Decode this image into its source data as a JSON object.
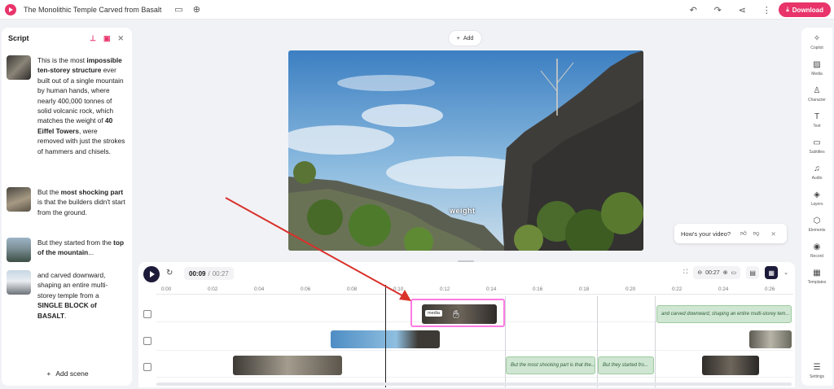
{
  "header": {
    "title": "The Monolithic Temple Carved from Basalt",
    "download_label": "Download"
  },
  "script_panel": {
    "title": "Script",
    "add_scene_label": "Add scene",
    "scenes": [
      {
        "pre": "This is the most ",
        "b1": "impossible ten-storey structure",
        "mid": " ever built out of a single mountain by human hands, where nearly 400,000 tonnes of solid volcanic rock, which matches the weight of ",
        "b2": "40 Eiffel Towers",
        "post": ", were removed with just the strokes of hammers and chisels."
      },
      {
        "pre": "But the ",
        "b1": "most shocking part",
        "mid": " is that the builders didn't start from the ground.",
        "b2": "",
        "post": ""
      },
      {
        "pre": "But they started from the ",
        "b1": "top of the mountain",
        "mid": "...",
        "b2": "",
        "post": ""
      },
      {
        "pre": "and carved downward, shaping an entire multi-storey temple from a ",
        "b1": "SINGLE BLOCK of BASALT",
        "mid": ".",
        "b2": "",
        "post": ""
      }
    ]
  },
  "canvas": {
    "add_label": "Add",
    "caption_word": "weight"
  },
  "feedback": {
    "question": "How's your video?"
  },
  "timeline": {
    "current_time": "00:09",
    "separator": "/",
    "total_time": "00:27",
    "zoom_value": "00:27",
    "ruler_ticks": [
      "0:00",
      "0:02",
      "0:04",
      "0:06",
      "0:08",
      "0:10",
      "0:12",
      "0:14",
      "0:16",
      "0:18",
      "0:20",
      "0:22",
      "0:24",
      "0:26"
    ],
    "media_tag": "media",
    "text_clips": [
      "and carved downward, shaping an entire multi-storey tem...",
      "But the most shocking part is that the...",
      "But they started fro..."
    ]
  },
  "rail": [
    {
      "label": "Copilot",
      "icon": "sparkle-icon"
    },
    {
      "label": "Media",
      "icon": "image-icon"
    },
    {
      "label": "Character",
      "icon": "person-icon"
    },
    {
      "label": "Text",
      "icon": "text-icon"
    },
    {
      "label": "Subtitles",
      "icon": "subtitles-icon"
    },
    {
      "label": "Audio",
      "icon": "music-icon"
    },
    {
      "label": "Layers",
      "icon": "layers-icon"
    },
    {
      "label": "Elements",
      "icon": "shapes-icon"
    },
    {
      "label": "Record",
      "icon": "record-icon"
    },
    {
      "label": "Templates",
      "icon": "grid-icon"
    },
    {
      "label": "Settings",
      "icon": "sliders-icon"
    }
  ],
  "colors": {
    "accent": "#e8346a",
    "selection": "#ff7ae2",
    "annotation_arrow": "#d9312b",
    "text_clip": "#cfe6d2"
  }
}
